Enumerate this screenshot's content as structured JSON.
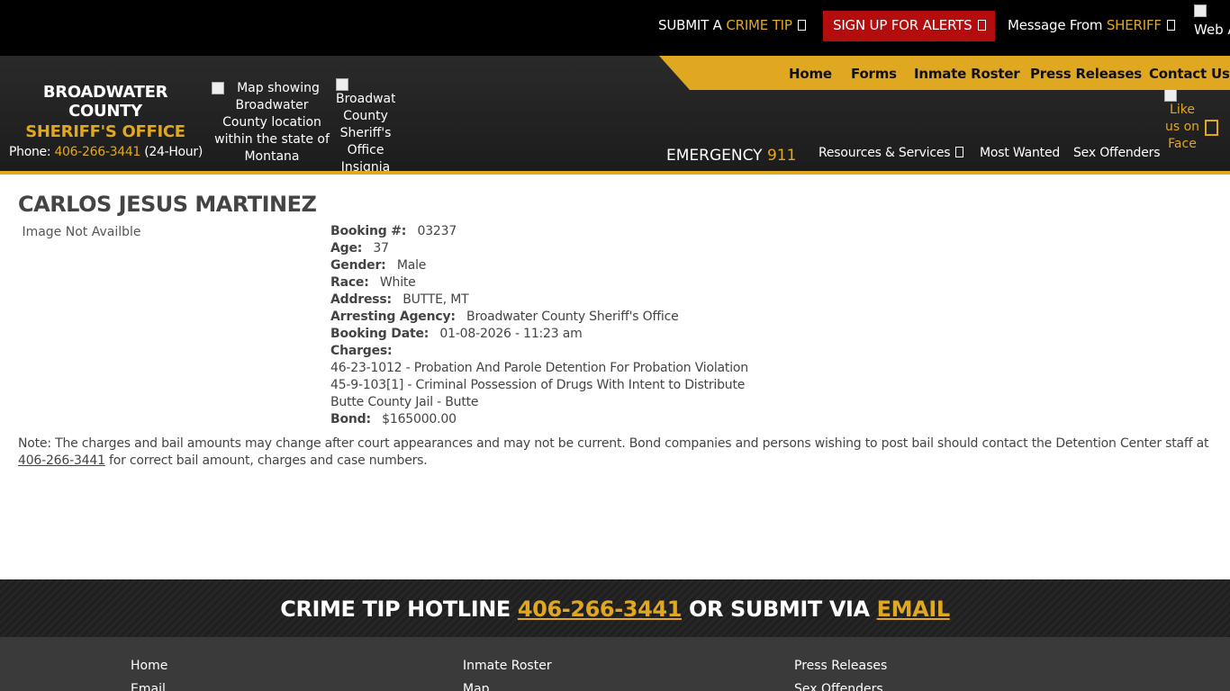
{
  "topbar": {
    "crime_tip_prefix": "SUBMIT A",
    "crime_tip_accent": "CRIME TIP",
    "alerts_label": "SIGN UP FOR ALERTS",
    "sheriff_prefix": "Message From",
    "sheriff_accent": "SHERIFF",
    "web_access_alt": "Web Acce"
  },
  "header": {
    "title_line1": "BROADWATER COUNTY",
    "title_line2": "SHERIFF'S OFFICE",
    "phone_label": "Phone:",
    "phone_number": "406-266-3441",
    "phone_suffix": "(24-Hour)",
    "map_alt": "Map showing Broadwater County location within the state of Montana",
    "insignia_alt": "Broadwater County Sheriff's Office Insignia",
    "emergency_label": "EMERGENCY",
    "emergency_number": "911",
    "facebook_alt": "Like us on Face"
  },
  "nav_primary": [
    {
      "label": "Home"
    },
    {
      "label": "Forms"
    },
    {
      "label": "Inmate Roster"
    },
    {
      "label": "Press Releases"
    },
    {
      "label": "Contact Us"
    }
  ],
  "nav_secondary": [
    {
      "label": "Resources & Services"
    },
    {
      "label": "Most Wanted"
    },
    {
      "label": "Sex Offenders"
    }
  ],
  "inmate": {
    "name": "CARLOS JESUS MARTINEZ",
    "photo_alt": "Image Not Availble",
    "fields": [
      {
        "label": "Booking #:",
        "value": "03237"
      },
      {
        "label": "Age:",
        "value": "37"
      },
      {
        "label": "Gender:",
        "value": "Male"
      },
      {
        "label": "Race:",
        "value": "White"
      },
      {
        "label": "Address:",
        "value": "BUTTE, MT"
      },
      {
        "label": "Arresting Agency:",
        "value": "Broadwater County Sheriff's Office"
      },
      {
        "label": "Booking Date:",
        "value": "01-08-2026 - 11:23 am"
      },
      {
        "label": "Charges:",
        "value": ""
      }
    ],
    "charges": [
      "46-23-1012 - Probation And Parole Detention For Probation Violation",
      "45-9-103[1] - Criminal Possession of Drugs With Intent to Distribute",
      "Butte County Jail - Butte"
    ],
    "bond_label": "Bond:",
    "bond_value": "$165000.00"
  },
  "note": {
    "text_before": "Note: The charges and bail amounts may change after court appearances and may not be current. Bond companies and persons wishing to post bail should contact the Detention Center staff at ",
    "phone": "406-266-3441",
    "text_after": " for correct bail amount, charges and case numbers."
  },
  "footer": {
    "hotline_prefix": "CRIME TIP HOTLINE",
    "hotline_phone": "406-266-3441",
    "hotline_middle": "OR SUBMIT VIA",
    "hotline_email": "EMAIL",
    "links": [
      {
        "label": "Home"
      },
      {
        "label": "Inmate Roster"
      },
      {
        "label": "Press Releases"
      },
      {
        "label": "Email"
      },
      {
        "label": "Map"
      },
      {
        "label": "Sex Offenders"
      }
    ]
  },
  "colors": {
    "accent": "#e0a820",
    "alert_red": "#b30d0d",
    "header_dark": "#1c1c1c"
  }
}
